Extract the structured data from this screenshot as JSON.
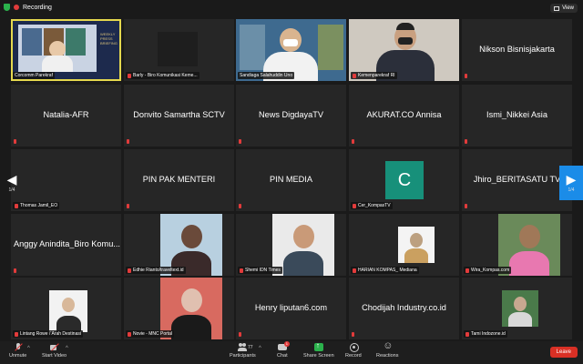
{
  "topbar": {
    "recording_label": "Recording",
    "view_label": "View"
  },
  "tiles": [
    {
      "name": "",
      "label": "Corcomm Parekraf",
      "mic_muted": false,
      "kind": "slide"
    },
    {
      "name": "",
      "label": "Barly - Biro Komunikasi Keme...",
      "mic_muted": true,
      "kind": "blank"
    },
    {
      "name": "",
      "label": "Sandiaga Salahuddin Uno",
      "mic_muted": false,
      "kind": "person-bg"
    },
    {
      "name": "",
      "label": "Kemenparekraf RI",
      "mic_muted": true,
      "kind": "person"
    },
    {
      "name": "Nikson Bisnisjakarta",
      "label": "",
      "mic_muted": true,
      "kind": "text"
    },
    {
      "name": "Natalia-AFR",
      "label": "",
      "mic_muted": true,
      "kind": "text"
    },
    {
      "name": "Donvito Samartha SCTV",
      "label": "",
      "mic_muted": true,
      "kind": "text"
    },
    {
      "name": "News DigdayaTV",
      "label": "",
      "mic_muted": true,
      "kind": "text"
    },
    {
      "name": "AKURAT.CO Annisa",
      "label": "",
      "mic_muted": true,
      "kind": "text"
    },
    {
      "name": "Ismi_Nikkei Asia",
      "label": "",
      "mic_muted": true,
      "kind": "text"
    },
    {
      "name": "",
      "label": "Thomas Jamil_EO",
      "mic_muted": true,
      "kind": "blank"
    },
    {
      "name": "PIN PAK MENTERI",
      "label": "",
      "mic_muted": true,
      "kind": "text"
    },
    {
      "name": "PIN MEDIA",
      "label": "",
      "mic_muted": true,
      "kind": "text"
    },
    {
      "name": "",
      "label": "Cer_KompasTV",
      "mic_muted": true,
      "kind": "avatar",
      "avatar_letter": "C"
    },
    {
      "name": "Jhiro_BERITASATU TV",
      "label": "",
      "mic_muted": true,
      "kind": "text"
    },
    {
      "name": "Anggy Anindita_Biro Komu...",
      "label": "",
      "mic_muted": true,
      "kind": "text"
    },
    {
      "name": "",
      "label": "Edhie Rianto/traveltext.id",
      "mic_muted": true,
      "kind": "photo1"
    },
    {
      "name": "",
      "label": "Shemi IDN Times",
      "mic_muted": true,
      "kind": "photo2"
    },
    {
      "name": "",
      "label": "HARIAN KOMPAS_ Mediana",
      "mic_muted": true,
      "kind": "photo3"
    },
    {
      "name": "",
      "label": "Wira_Kompas.com",
      "mic_muted": true,
      "kind": "photo4"
    },
    {
      "name": "",
      "label": "Lintang Rowe / Arah Destinasi",
      "mic_muted": true,
      "kind": "photo5"
    },
    {
      "name": "",
      "label": "Novie - MNC Portal",
      "mic_muted": true,
      "kind": "photo6"
    },
    {
      "name": "Henry liputan6.com",
      "label": "",
      "mic_muted": true,
      "kind": "text"
    },
    {
      "name": "Chodijah Industry.co.id",
      "label": "",
      "mic_muted": true,
      "kind": "text"
    },
    {
      "name": "",
      "label": "Tami Indozone.id",
      "mic_muted": true,
      "kind": "photo7"
    }
  ],
  "nav": {
    "left_page": "1/4",
    "right_page": "1/4"
  },
  "toolbar": {
    "unmute": "Unmute",
    "start_video": "Start Video",
    "participants": "Participants",
    "participants_count": "77",
    "chat": "Chat",
    "chat_badge": "1",
    "share_screen": "Share Screen",
    "record": "Record",
    "reactions": "Reactions",
    "leave": "Leave"
  },
  "colors": {
    "accent_share": "#2bb24c",
    "leave": "#d93025",
    "nav_right": "#1b8ce8",
    "active_tile": "#e5d84e",
    "avatar": "#17907a"
  }
}
